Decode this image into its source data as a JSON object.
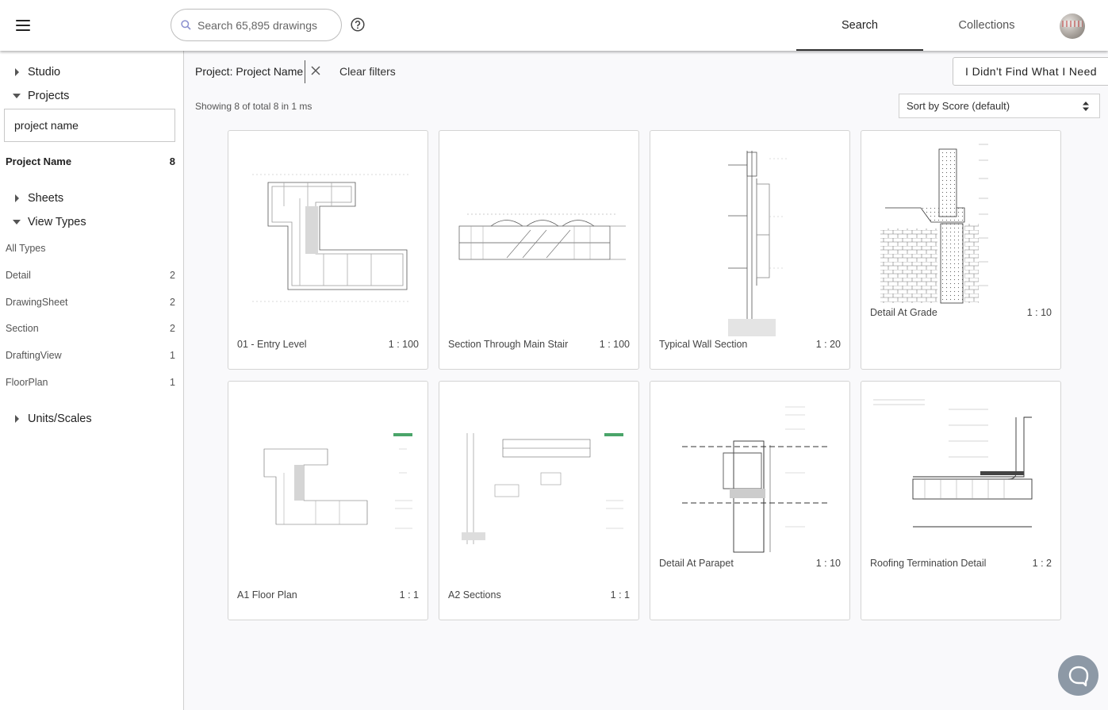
{
  "header": {
    "search_placeholder": "Search 65,895 drawings",
    "tabs": [
      {
        "label": "Search",
        "active": true
      },
      {
        "label": "Collections",
        "active": false
      }
    ],
    "icons": {
      "menu": "hamburger-icon",
      "search": "search-icon",
      "help": "help-circle-icon",
      "avatar": "user-avatar"
    }
  },
  "sidebar": {
    "studio": {
      "label": "Studio",
      "expanded": false
    },
    "projects": {
      "label": "Projects",
      "expanded": true,
      "filter_value": "project name",
      "items": [
        {
          "label": "Project Name",
          "count": "8"
        }
      ]
    },
    "sheets": {
      "label": "Sheets",
      "expanded": false
    },
    "view_types": {
      "label": "View Types",
      "expanded": true,
      "items": [
        {
          "label": "All Types",
          "count": ""
        },
        {
          "label": "Detail",
          "count": "2"
        },
        {
          "label": "DrawingSheet",
          "count": "2"
        },
        {
          "label": "Section",
          "count": "2"
        },
        {
          "label": "DraftingView",
          "count": "1"
        },
        {
          "label": "FloorPlan",
          "count": "1"
        }
      ]
    },
    "units_scales": {
      "label": "Units/Scales",
      "expanded": false
    }
  },
  "filters": {
    "active_chip": "Project: Project Name",
    "clear_label": "Clear filters",
    "not_found_label": "I Didn't Find What I Need"
  },
  "results": {
    "summary": "Showing 8 of total 8 in 1 ms",
    "sort_label": "Sort by Score (default)",
    "cards": [
      {
        "title": "01 - Entry Level",
        "scale": "1 : 100",
        "thumb": "floor-plan-drawing"
      },
      {
        "title": "Section Through Main Stair",
        "scale": "1 : 100",
        "thumb": "building-section-drawing"
      },
      {
        "title": "Typical Wall Section",
        "scale": "1 : 20",
        "thumb": "wall-section-drawing"
      },
      {
        "title": "Detail At Grade",
        "scale": "1 : 10",
        "thumb": "grade-detail-drawing"
      },
      {
        "title": "A1 Floor Plan",
        "scale": "1 : 1",
        "thumb": "floor-plan-sheet"
      },
      {
        "title": "A2 Sections",
        "scale": "1 : 1",
        "thumb": "sections-sheet"
      },
      {
        "title": "Detail At Parapet",
        "scale": "1 : 10",
        "thumb": "parapet-detail-drawing"
      },
      {
        "title": "Roofing Termination Detail",
        "scale": "1 : 2",
        "thumb": "roofing-detail-drawing"
      }
    ]
  },
  "chat": {
    "icon": "chat-bubble-icon"
  },
  "colors": {
    "accent": "#333333",
    "chat_button": "#8d99a6",
    "main_bg": "#f9f9fb",
    "border": "#d4d4d4"
  }
}
